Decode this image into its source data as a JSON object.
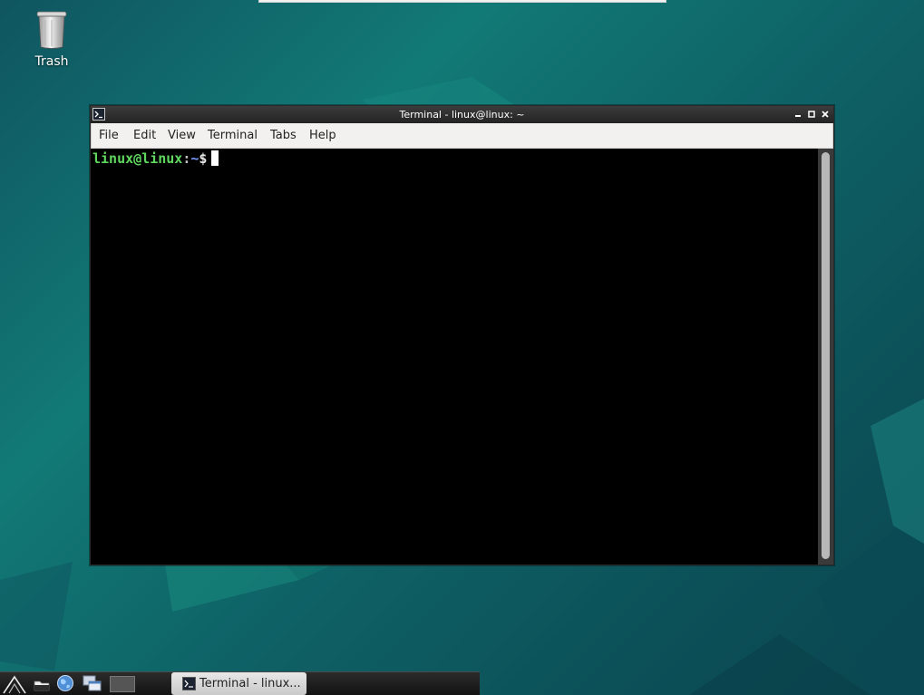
{
  "desktop": {
    "icons": [
      {
        "label": "Trash",
        "icon": "trash-icon"
      }
    ]
  },
  "window": {
    "title": "Terminal - linux@linux: ~",
    "app_icon": "terminal-icon",
    "controls": [
      "minimize-icon",
      "maximize-icon",
      "close-icon"
    ],
    "menu": [
      "File",
      "Edit",
      "View",
      "Terminal",
      "Tabs",
      "Help"
    ],
    "prompt": {
      "user_host": "linux@linux",
      "separator": ":",
      "path": "~",
      "symbol": "$"
    }
  },
  "taskbar": {
    "launchers": [
      "start-menu-icon",
      "file-manager-icon",
      "web-browser-icon",
      "show-desktop-icon",
      "workspace-switcher-icon"
    ],
    "task": {
      "label": "Terminal - linux...",
      "icon": "terminal-icon"
    }
  },
  "colors": {
    "prompt_user": "#5fd75f",
    "prompt_path": "#7b9cff",
    "desktop_bg": "#0e6266"
  }
}
